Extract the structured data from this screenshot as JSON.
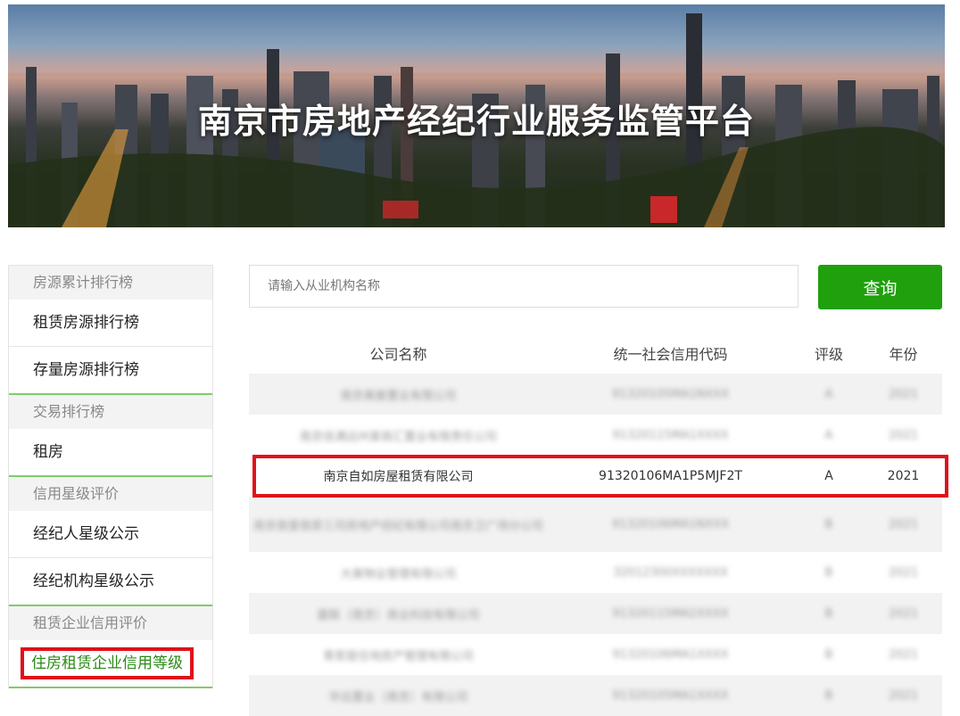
{
  "banner": {
    "title": "南京市房地产经纪行业服务监管平台"
  },
  "sidebar": {
    "groups": [
      {
        "section": "房源累计排行榜",
        "items": [
          "租赁房源排行榜",
          "存量房源排行榜"
        ]
      },
      {
        "section": "交易排行榜",
        "items": [
          "租房"
        ]
      },
      {
        "section": "信用星级评价",
        "items": [
          "经纪人星级公示",
          "经纪机构星级公示"
        ]
      },
      {
        "section": "租赁企业信用评价",
        "items": [
          "住房租赁企业信用等级"
        ]
      }
    ]
  },
  "search": {
    "placeholder": "请输入从业机构名称",
    "button": "查询"
  },
  "table": {
    "headers": [
      "公司名称",
      "统一社会信用代码",
      "评级",
      "年份"
    ],
    "rows": [
      [
        "南京美屋置业有限公司",
        "91320105MA1NXXX",
        "A",
        "2021"
      ],
      [
        "南京佳满远州某商汇置业有限责任公司",
        "91320115MA1XXXX",
        "A",
        "2021"
      ],
      [
        "南京自如房屋租赁有限公司",
        "91320106MA1P5MJF2T",
        "A",
        "2021"
      ],
      [
        "南京我爱我家三司房地产经纪有限公司南京卫广场分公司",
        "91320106MA1NXXX",
        "B",
        "2021"
      ],
      [
        "大美物业管理有限公司",
        "32012300XXXXXXX",
        "B",
        "2021"
      ],
      [
        "嘉联（南京）商业科技有限公司",
        "91320115MA2XXXX",
        "B",
        "2021"
      ],
      [
        "青家居住地房产管理有限公司",
        "91320106MA1XXXX",
        "B",
        "2021"
      ],
      [
        "华远置业（南京）有限公司",
        "91320105MA1XXXX",
        "B",
        "2021"
      ]
    ]
  }
}
